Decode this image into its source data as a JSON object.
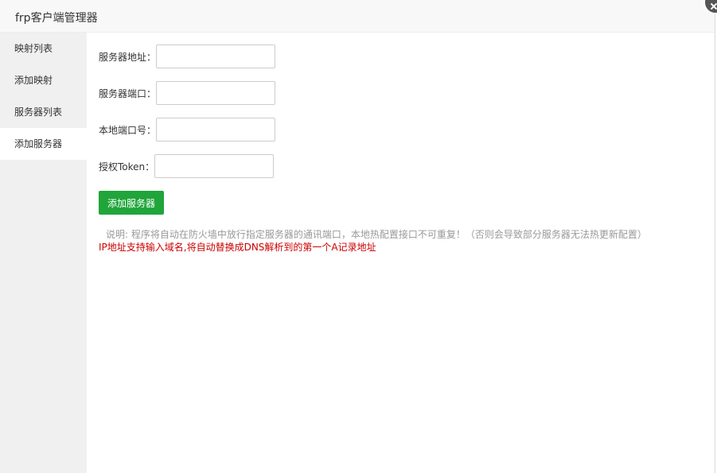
{
  "window": {
    "title": "frp客户端管理器"
  },
  "sidebar": {
    "items": [
      {
        "label": "映射列表"
      },
      {
        "label": "添加映射"
      },
      {
        "label": "服务器列表"
      },
      {
        "label": "添加服务器",
        "active": true
      }
    ]
  },
  "form": {
    "server_address_label": "服务器地址：",
    "server_address_value": "",
    "server_port_label": "服务器端口：",
    "server_port_value": "",
    "local_port_label": "本地端口号：",
    "local_port_value": "",
    "token_label": "授权Token：",
    "token_value": "",
    "submit_label": "添加服务器"
  },
  "notes": {
    "description": "说明: 程序将自动在防火墙中放行指定服务器的通讯端口，本地热配置接口不可重复！（否则会导致部分服务器无法热更新配置）",
    "warning": "IP地址支持输入域名,将自动替换成DNS解析到的第一个A记录地址"
  },
  "colors": {
    "primary_button": "#20a53a",
    "warning_text": "#cc0000",
    "sidebar_bg": "#f0f0f0"
  }
}
